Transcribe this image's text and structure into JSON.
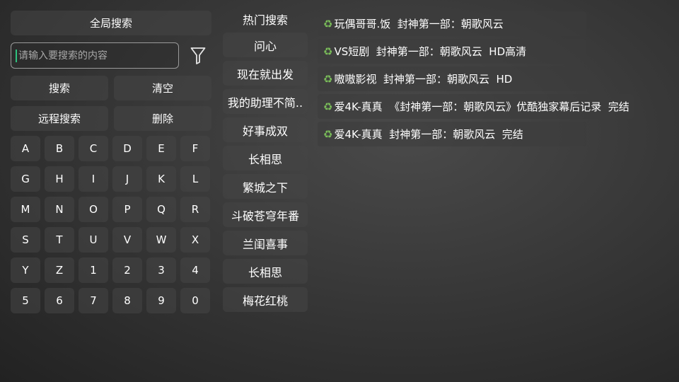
{
  "colors": {
    "accent_caret": "#2ec27e",
    "recycle_icon": "#7bbf5a",
    "button_bg": "#464646"
  },
  "left_panel": {
    "global_search_label": "全局搜索",
    "search_placeholder": "请输入要搜索的内容",
    "search_value": "",
    "filter_icon": "filter-icon",
    "search_label": "搜索",
    "clear_label": "清空",
    "remote_search_label": "远程搜索",
    "delete_label": "删除"
  },
  "keyboard": {
    "keys": [
      "A",
      "B",
      "C",
      "D",
      "E",
      "F",
      "G",
      "H",
      "I",
      "J",
      "K",
      "L",
      "M",
      "N",
      "O",
      "P",
      "Q",
      "R",
      "S",
      "T",
      "U",
      "V",
      "W",
      "X",
      "Y",
      "Z",
      "1",
      "2",
      "3",
      "4",
      "5",
      "6",
      "7",
      "8",
      "9",
      "0"
    ]
  },
  "hot": {
    "title": "热门搜索",
    "items": [
      "问心",
      "现在就出发",
      "我的助理不简..",
      "好事成双",
      "长相思",
      "繁城之下",
      "斗破苍穹年番",
      "兰闺喜事",
      "长相思",
      "梅花红桃"
    ]
  },
  "results": {
    "icon": "recycle-icon",
    "items": [
      "玩偶哥哥.饭  封神第一部：朝歌风云",
      "VS短剧  封神第一部：朝歌风云  HD高清",
      "嗷嗷影视  封神第一部：朝歌风云  HD",
      "爱4K-真真  《封神第一部：朝歌风云》优酷独家幕后记录  完结",
      "爱4K-真真  封神第一部：朝歌风云  完结"
    ]
  }
}
